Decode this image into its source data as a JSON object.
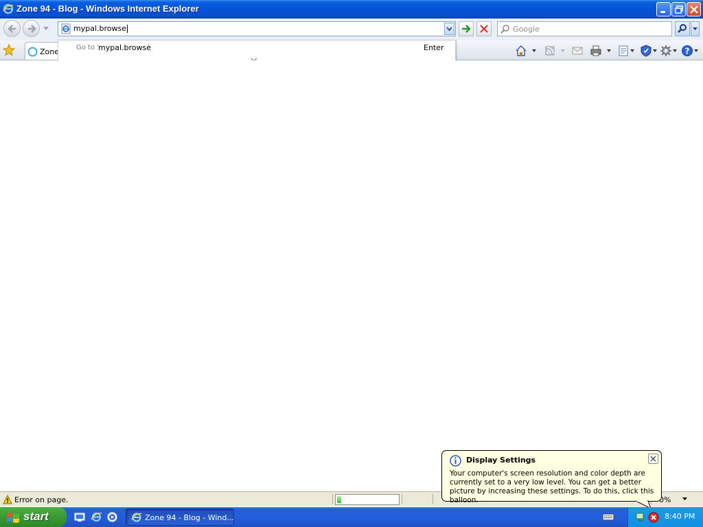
{
  "window": {
    "title": "Zone 94 - Blog - Windows Internet Explorer",
    "icon": "ie-icon",
    "controls": [
      "minimize-icon",
      "restore-icon",
      "close-icon"
    ]
  },
  "navbar": {
    "back": "back-arrow-icon",
    "forward": "forward-arrow-icon",
    "address_value": "mypal.browse",
    "go": "go-arrow-icon",
    "stop": "stop-x-icon",
    "search_placeholder": "Google"
  },
  "suggestion": {
    "prefix": "Go to '",
    "target": "mypal.browse",
    "suffix": "'",
    "action": "Enter"
  },
  "tabs": [
    {
      "label": "Zone"
    }
  ],
  "toolbar": [
    "home-icon",
    "feeds-icon",
    "mail-icon",
    "print-icon",
    "page-icon",
    "safety-icon",
    "tools-icon",
    "help-icon"
  ],
  "statusbar": {
    "text": "Error on page.",
    "progress_fraction": 0.05,
    "zoom": "0%"
  },
  "balloon": {
    "title": "Display Settings",
    "body": "Your computer's screen resolution and color depth are currently set to a very low level. You can get a better picture by increasing these settings. To do this, click this balloon."
  },
  "taskbar": {
    "start_label": "start",
    "quicklaunch": [
      "show-desktop-icon",
      "ie-icon",
      "media-player-icon"
    ],
    "active_task": "Zone 94 - Blog - Wind...",
    "clock": "8:40 PM"
  },
  "colors": {
    "titlebar": "#0553d8",
    "taskbar": "#245ddb",
    "start_button": "#3a9a32",
    "balloon_bg": "#ffffe1",
    "statusbar_bg": "#ece9d8"
  }
}
